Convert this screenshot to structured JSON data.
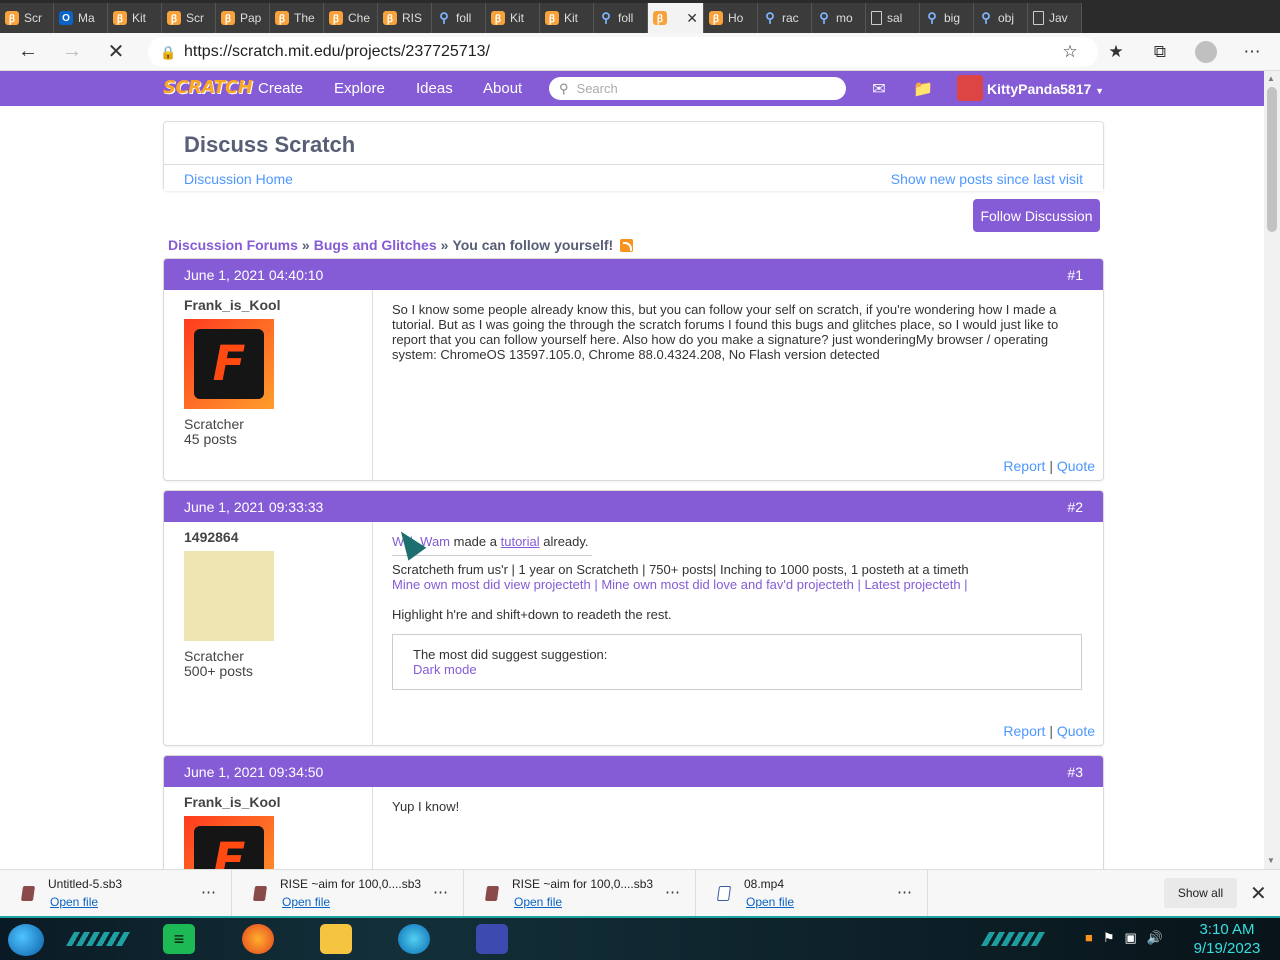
{
  "browser": {
    "tabs": [
      {
        "icon": "scratch",
        "label": "Scr"
      },
      {
        "icon": "outlook",
        "label": "Ma"
      },
      {
        "icon": "scratch",
        "label": "Kit"
      },
      {
        "icon": "scratch",
        "label": "Scr"
      },
      {
        "icon": "scratch",
        "label": "Pap"
      },
      {
        "icon": "scratch",
        "label": "The"
      },
      {
        "icon": "scratch",
        "label": "Che"
      },
      {
        "icon": "scratch",
        "label": "RIS"
      },
      {
        "icon": "search",
        "label": "foll"
      },
      {
        "icon": "scratch",
        "label": "Kit"
      },
      {
        "icon": "scratch",
        "label": "Kit"
      },
      {
        "icon": "search",
        "label": "foll"
      },
      {
        "icon": "scratch",
        "label": "",
        "active": true
      },
      {
        "icon": "scratch",
        "label": "Ho"
      },
      {
        "icon": "search",
        "label": "rac"
      },
      {
        "icon": "search",
        "label": "mo"
      },
      {
        "icon": "page",
        "label": "sal"
      },
      {
        "icon": "search",
        "label": "big"
      },
      {
        "icon": "search",
        "label": "obj"
      },
      {
        "icon": "page",
        "label": "Jav"
      }
    ],
    "url": "https://scratch.mit.edu/projects/237725713/"
  },
  "nav": {
    "logo": "SCRATCH",
    "links": [
      "Create",
      "Explore",
      "Ideas",
      "About"
    ],
    "search_placeholder": "Search",
    "username": "KittyPanda5817"
  },
  "discuss": {
    "title": "Discuss Scratch",
    "home_link": "Discussion Home",
    "new_posts_link": "Show new posts since last visit",
    "follow_button": "Follow Discussion"
  },
  "breadcrumb": {
    "forums": "Discussion Forums",
    "sep": "»",
    "category": "Bugs and Glitches",
    "topic": "You can follow yourself!"
  },
  "posts": [
    {
      "date": "June 1, 2021 04:40:10",
      "number": "#1",
      "author": "Frank_is_Kool",
      "rank": "Scratcher",
      "post_count": "45 posts",
      "body": "So I know some people already know this, but you can follow your self on scratch, if you're wondering how I made a tutorial. But as I was going the through the scratch forums I found this bugs and glitches place, so I would just like to report that you can follow yourself here. Also how do you make a signature? just wonderingMy browser / operating system: ChromeOS 13597.105.0, Chrome 88.0.4324.208, No Flash version detected",
      "report": "Report",
      "quote": "Quote"
    },
    {
      "date": "June 1, 2021 09:33:33",
      "number": "#2",
      "author": "1492864",
      "rank": "Scratcher",
      "post_count": "500+ posts",
      "body_user": "Will_Wam",
      "body_mid": " made a ",
      "body_link": "tutorial",
      "body_end": " already.",
      "sig_line1": "Scratcheth frum us'r | 1 year on Scratcheth | 750+ posts| Inching to 1000 posts, 1 posteth at a timeth",
      "sig_link1": "Mine own most did view projecteth",
      "sig_link2": "Mine own most did love and fav'd projecteth",
      "sig_link3": "Latest projecteth",
      "sig_sep": " | ",
      "sig_line3": "Highlight h're and shift+down to readeth the rest.",
      "sig_box_title": "The most did suggest suggestion:",
      "sig_box_link": "Dark mode",
      "report": "Report",
      "quote": "Quote"
    },
    {
      "date": "June 1, 2021 09:34:50",
      "number": "#3",
      "author": "Frank_is_Kool",
      "body": "Yup I know!"
    }
  ],
  "downloads": [
    {
      "name": "Untitled-5.sb3",
      "open": "Open file",
      "type": "sb3"
    },
    {
      "name": "RISE ~aim for 100,0....sb3",
      "open": "Open file",
      "type": "sb3"
    },
    {
      "name": "RISE ~aim for 100,0....sb3",
      "open": "Open file",
      "type": "sb3"
    },
    {
      "name": "08.mp4",
      "open": "Open file",
      "type": "video"
    }
  ],
  "downloads_show_all": "Show all",
  "taskbar": {
    "time": "3:10 AM",
    "date": "9/19/2023"
  },
  "colors": {
    "scratch_purple": "#855cd6",
    "link_blue": "#4d97ff",
    "taskbar_accent": "#36e0e0"
  }
}
